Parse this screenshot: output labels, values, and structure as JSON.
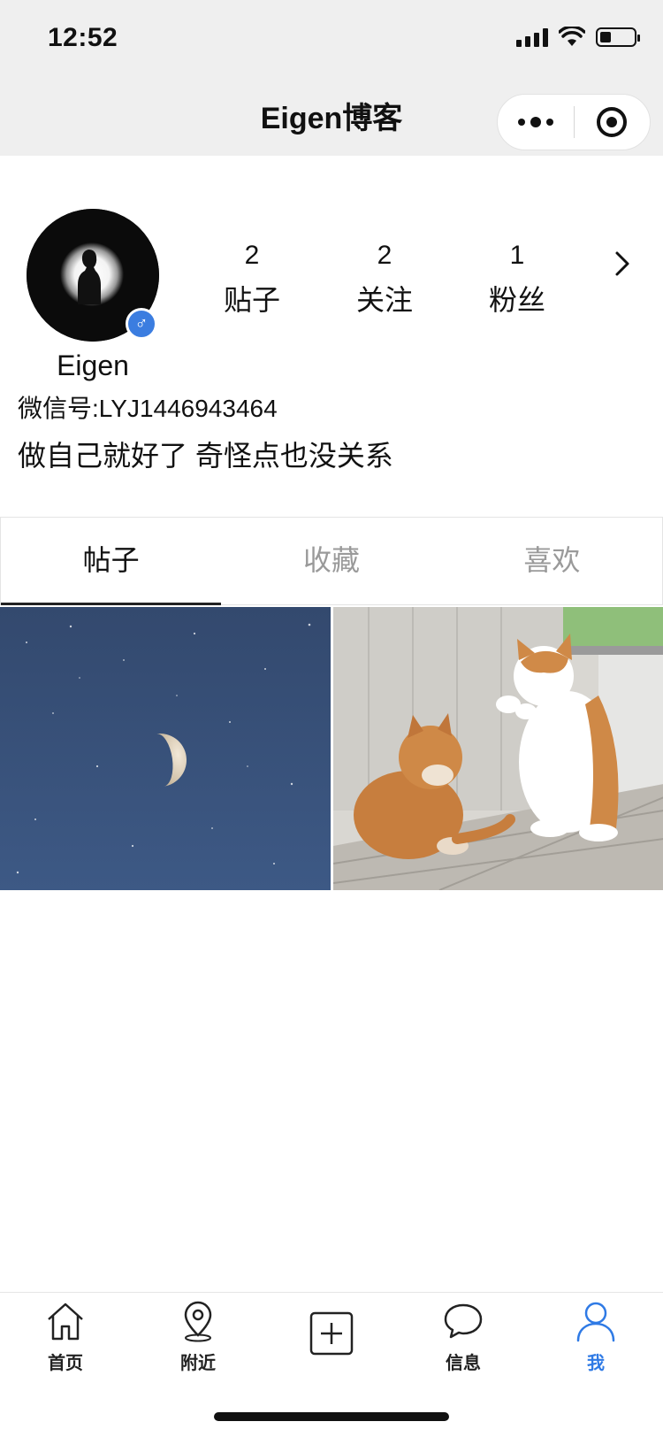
{
  "status_bar": {
    "time": "12:52"
  },
  "nav": {
    "title": "Eigen博客"
  },
  "profile": {
    "username": "Eigen",
    "wechat_id": "微信号:LYJ1446943464",
    "bio": "做自己就好了 奇怪点也没关系",
    "gender_icon": "male-icon",
    "stats": [
      {
        "count": "2",
        "label": "贴子"
      },
      {
        "count": "2",
        "label": "关注"
      },
      {
        "count": "1",
        "label": "粉丝"
      }
    ]
  },
  "tabs": [
    {
      "label": "帖子",
      "active": true
    },
    {
      "label": "收藏",
      "active": false
    },
    {
      "label": "喜欢",
      "active": false
    }
  ],
  "tab_bar": [
    {
      "label": "首页",
      "icon": "home-icon"
    },
    {
      "label": "附近",
      "icon": "location-pin-icon"
    },
    {
      "label": "",
      "icon": "add-square-icon"
    },
    {
      "label": "信息",
      "icon": "chat-bubble-icon"
    },
    {
      "label": "我",
      "icon": "user-icon",
      "active": true
    }
  ],
  "colors": {
    "accent": "#2f7ae5",
    "nav_bg": "#efefef",
    "gender_badge": "#3b7de0"
  }
}
